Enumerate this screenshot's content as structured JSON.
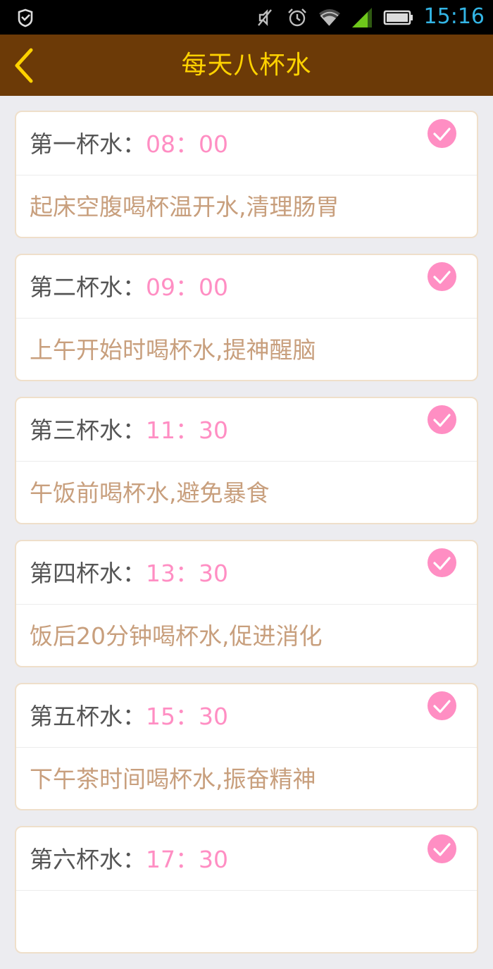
{
  "status_bar": {
    "time": "15:16",
    "icons": [
      "notification-icon",
      "mute-icon",
      "alarm-icon",
      "wifi-icon",
      "signal-icon",
      "battery-icon"
    ]
  },
  "header": {
    "title": "每天八杯水",
    "back_icon": "chevron-left-icon"
  },
  "colors": {
    "header_bg": "#6c3a07",
    "title": "#ffd200",
    "time_text": "#ff8ec3",
    "tip_text": "#c89f7d",
    "check": "#ff8ec3",
    "status_accent": "#33b5e5"
  },
  "cups": [
    {
      "label": "第一杯水：",
      "time": "08：00",
      "tip": "起床空腹喝杯温开水,清理肠胃",
      "checked": true
    },
    {
      "label": "第二杯水：",
      "time": "09：00",
      "tip": "上午开始时喝杯水,提神醒脑",
      "checked": true
    },
    {
      "label": "第三杯水：",
      "time": "11：30",
      "tip": "午饭前喝杯水,避免暴食",
      "checked": true
    },
    {
      "label": "第四杯水：",
      "time": "13：30",
      "tip": "饭后20分钟喝杯水,促进消化",
      "checked": true
    },
    {
      "label": "第五杯水：",
      "time": "15：30",
      "tip": "下午茶时间喝杯水,振奋精神",
      "checked": true
    },
    {
      "label": "第六杯水：",
      "time": "17：30",
      "tip": "",
      "checked": true
    }
  ]
}
